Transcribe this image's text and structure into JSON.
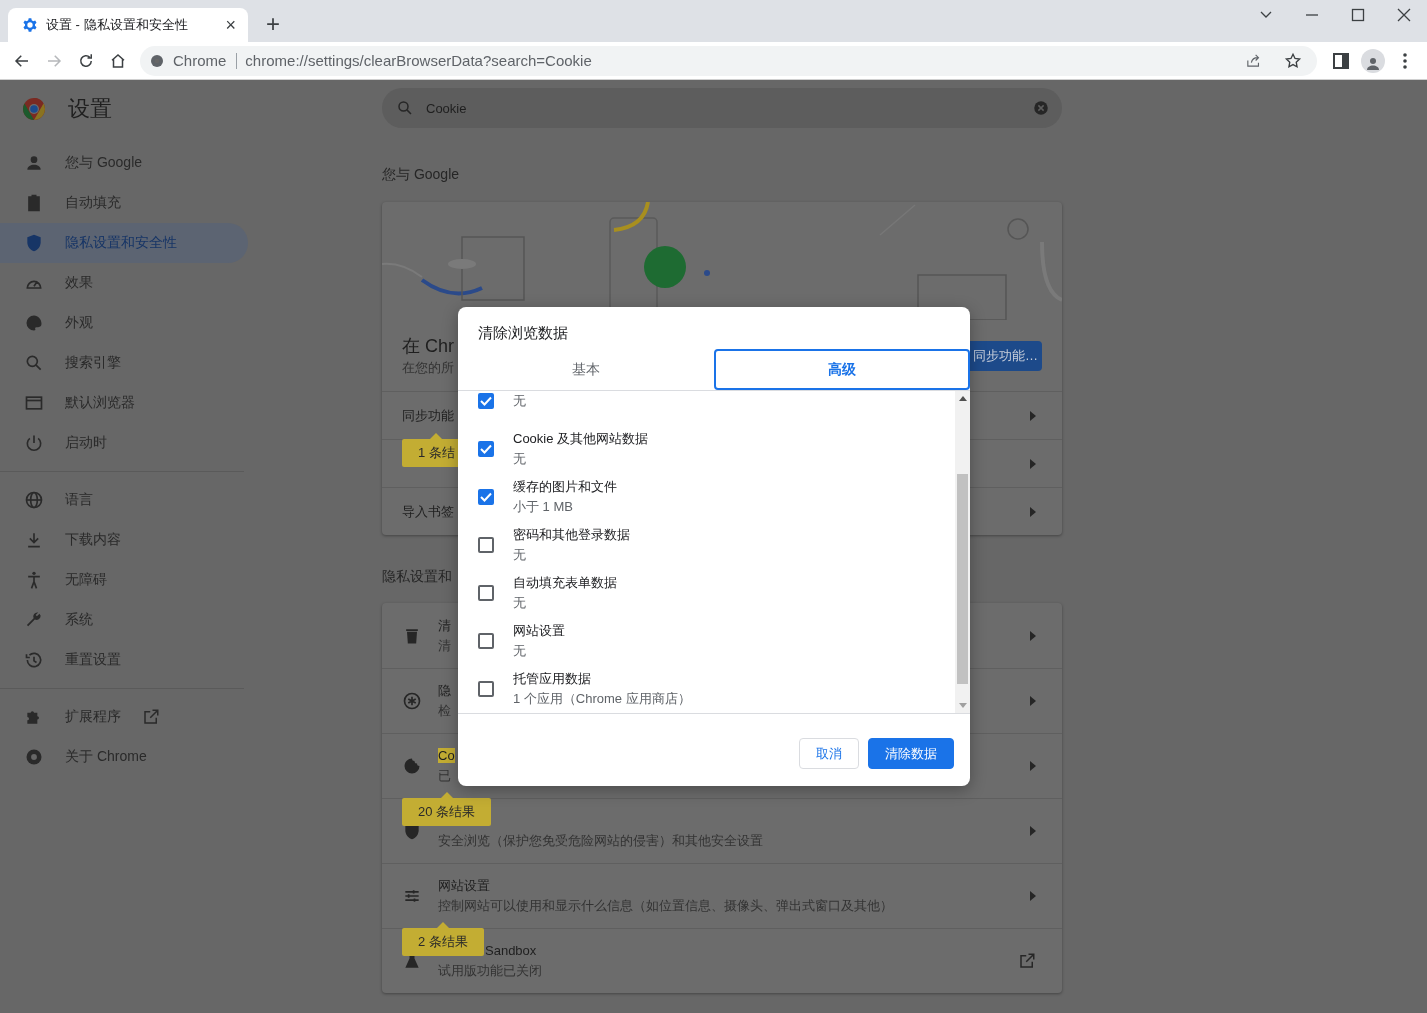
{
  "browser": {
    "tab": {
      "title": "设置 - 隐私设置和安全性",
      "close": "×"
    },
    "new_tab": "+",
    "forward": {
      "disabled": true
    },
    "omnibox": {
      "site_label": "Chrome",
      "url": "chrome://settings/clearBrowserData?search=Cookie"
    }
  },
  "settings": {
    "title": "设置",
    "search": {
      "value": "Cookie"
    },
    "nav": [
      [
        {
          "label": "您与 Google",
          "selected": false,
          "kind": "page"
        },
        {
          "label": "自动填充",
          "selected": false,
          "kind": "page"
        },
        {
          "label": "隐私设置和安全性",
          "selected": true,
          "kind": "page"
        },
        {
          "label": "效果",
          "selected": false,
          "kind": "page"
        },
        {
          "label": "外观",
          "selected": false,
          "kind": "page"
        },
        {
          "label": "搜索引擎",
          "selected": false,
          "kind": "page"
        },
        {
          "label": "默认浏览器",
          "selected": false,
          "kind": "page"
        },
        {
          "label": "启动时",
          "selected": false,
          "kind": "page"
        }
      ],
      [
        {
          "label": "语言",
          "selected": false,
          "kind": "page"
        },
        {
          "label": "下载内容",
          "selected": false,
          "kind": "page"
        },
        {
          "label": "无障碍",
          "selected": false,
          "kind": "page"
        },
        {
          "label": "系统",
          "selected": false,
          "kind": "page"
        },
        {
          "label": "重置设置",
          "selected": false,
          "kind": "page"
        }
      ],
      [
        {
          "label": "扩展程序",
          "selected": false,
          "kind": "link"
        },
        {
          "label": "关于 Chrome",
          "selected": false,
          "kind": "page"
        }
      ]
    ]
  },
  "sections": [
    {
      "heading": "您与 Google",
      "promo": {
        "title": "在 Chr",
        "subtitle": "在您的所",
        "button": "同步功能…"
      },
      "rows": [
        {
          "title": "同步功能",
          "kind": "arrow"
        },
        {
          "bubble": "1 条结",
          "kind": "arrow"
        },
        {
          "title": "导入书签",
          "kind": "arrow"
        }
      ]
    },
    {
      "heading": "隐私设置和",
      "rows": [
        {
          "title": "清",
          "subtitle": "清",
          "kind": "arrow"
        },
        {
          "title": "隐",
          "subtitle": "检",
          "kind": "arrow"
        },
        {
          "title": "Co",
          "highlighted": true,
          "subtitle": "已",
          "kind": "arrow"
        },
        {
          "bubble": "20 条结果",
          "subtitle": "安全浏览（保护您免受危险网站的侵害）和其他安全设置",
          "kind": "arrow"
        },
        {
          "title": "网站设置",
          "subtitle": "控制网站可以使用和显示什么信息（如位置信息、摄像头、弹出式窗口及其他）",
          "kind": "arrow"
        },
        {
          "bubble": "2 条结果",
          "title": "Sandbox",
          "subtitle": "试用版功能已关闭",
          "kind": "external"
        }
      ]
    }
  ],
  "dialog": {
    "title": "清除浏览数据",
    "tabs": [
      {
        "label": "基本",
        "selected": false
      },
      {
        "label": "高级",
        "selected": true
      }
    ],
    "items": [
      {
        "detail": "无",
        "checked": true
      },
      {
        "label": "Cookie 及其他网站数据",
        "detail": "无",
        "checked": true
      },
      {
        "label": "缓存的图片和文件",
        "detail": "小于 1 MB",
        "checked": true
      },
      {
        "label": "密码和其他登录数据",
        "detail": "无",
        "checked": false
      },
      {
        "label": "自动填充表单数据",
        "detail": "无",
        "checked": false
      },
      {
        "label": "网站设置",
        "detail": "无",
        "checked": false
      },
      {
        "label": "托管应用数据",
        "detail": "1 个应用（Chrome 应用商店）",
        "checked": false
      }
    ],
    "buttons": [
      {
        "label": "取消",
        "kind": "secondary"
      },
      {
        "label": "清除数据",
        "kind": "primary"
      }
    ]
  }
}
